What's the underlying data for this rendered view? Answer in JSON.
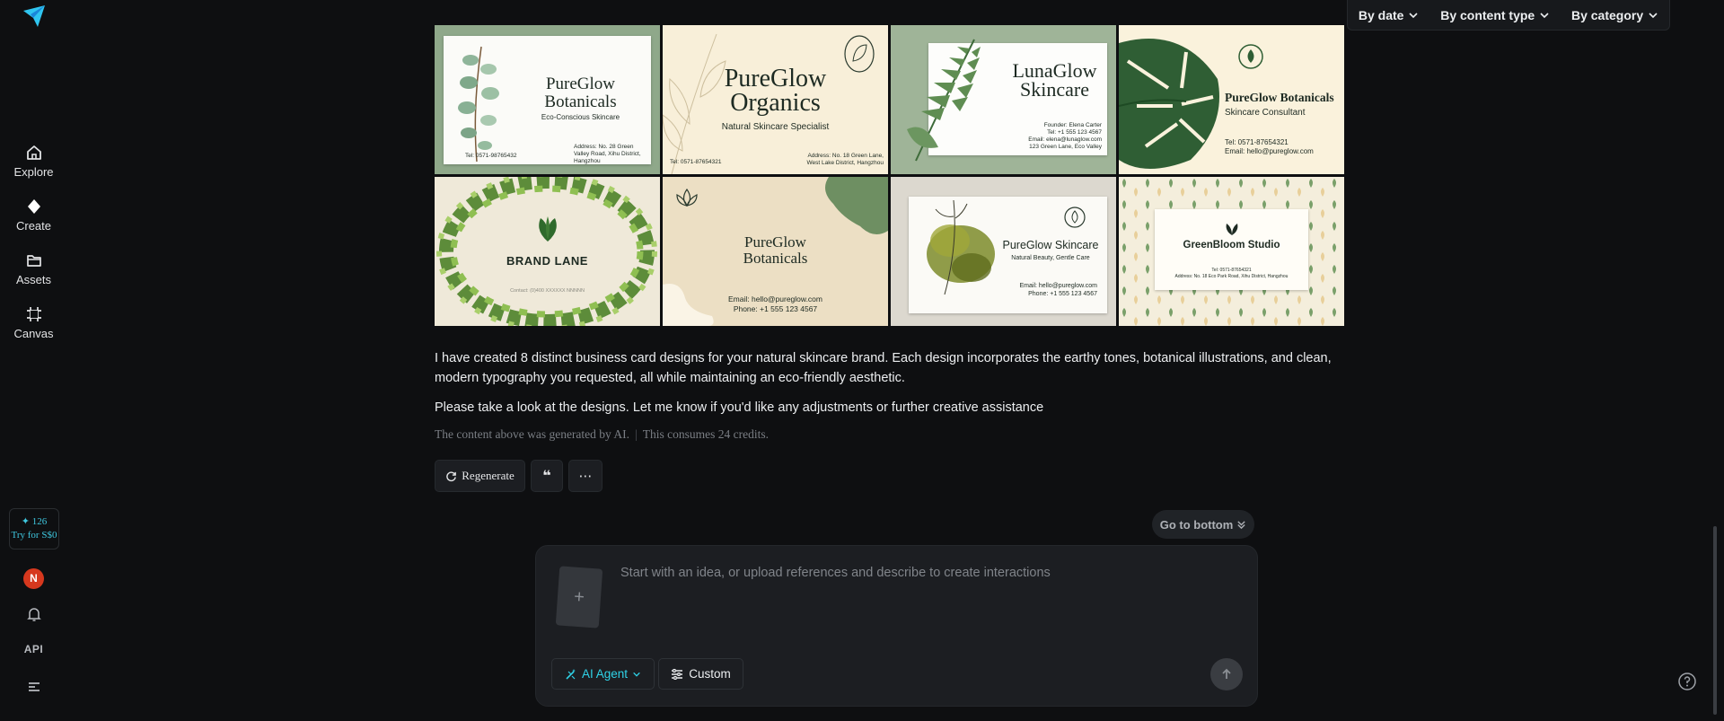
{
  "sidebar": {
    "items": [
      {
        "label": "Explore",
        "icon": "home-icon"
      },
      {
        "label": "Create",
        "icon": "diamond-icon"
      },
      {
        "label": "Assets",
        "icon": "folder-icon"
      },
      {
        "label": "Canvas",
        "icon": "canvas-icon"
      }
    ],
    "credits": {
      "count": "126",
      "try_label": "Try for S$0"
    },
    "avatar_initial": "N",
    "api_label": "API"
  },
  "filters": {
    "by_date": "By date",
    "by_content_type": "By content type",
    "by_category": "By category"
  },
  "cards": [
    {
      "title_line1": "PureGlow",
      "title_line2": "Botanicals",
      "subtitle": "Eco-Conscious Skincare",
      "address": "Address: No. 28 Green Valley Road, Xihu District, Hangzhou",
      "tel": "Tel: 0571-98765432"
    },
    {
      "title_line1": "PureGlow",
      "title_line2": "Organics",
      "subtitle": "Natural Skincare Specialist",
      "tel": "Tel: 0571-87654321",
      "address": "Address: No. 18 Green Lane, West Lake District, Hangzhou"
    },
    {
      "title_line1": "LunaGlow",
      "title_line2": "Skincare",
      "founder": "Founder: Elena Carter",
      "tel": "Tel: +1 555 123 4567",
      "email": "Email: elena@lunaglow.com",
      "address": "123 Green Lane, Eco Valley"
    },
    {
      "title": "PureGlow Botanicals",
      "subtitle": "Skincare Consultant",
      "tel": "Tel: 0571-87654321",
      "email": "Email: hello@pureglow.com"
    },
    {
      "title": "BRAND LANE",
      "contact": "Contact: (0)400 XXXXXX NNNNN"
    },
    {
      "title_line1": "PureGlow",
      "title_line2": "Botanicals",
      "email": "Email: hello@pureglow.com",
      "phone": "Phone: +1 555 123 4567"
    },
    {
      "title": "PureGlow Skincare",
      "subtitle": "Natural Beauty, Gentle Care",
      "email": "Email: hello@pureglow.com",
      "phone": "Phone: +1 555 123 4567"
    },
    {
      "title": "GreenBloom Studio",
      "tel": "Tel: 0571-87654321",
      "address": "Address: No. 18 Eco Park Road, Xihu District, Hangzhou"
    }
  ],
  "message": {
    "paragraph1": "I have created 8 distinct business card designs for your natural skincare brand. Each design incorporates the earthy tones, botanical illustrations, and clean, modern typography you requested, all while maintaining an eco-friendly aesthetic.",
    "paragraph2": "Please take a look at the designs. Let me know if you'd like any adjustments or further creative assistance",
    "ai_note": "The content above was generated by AI.",
    "credits_note": "This consumes 24 credits."
  },
  "actions": {
    "regenerate": "Regenerate",
    "quote_glyph": "❝",
    "more_glyph": "⋯"
  },
  "go_bottom": "Go to bottom",
  "composer": {
    "placeholder": "Start with an idea, or upload references and describe to create interactions",
    "agent_label": "AI Agent",
    "custom_label": "Custom",
    "upload_glyph": "+"
  },
  "colors": {
    "accent": "#2fd3e8",
    "background": "#0e0f11",
    "avatar": "#d6381e"
  }
}
